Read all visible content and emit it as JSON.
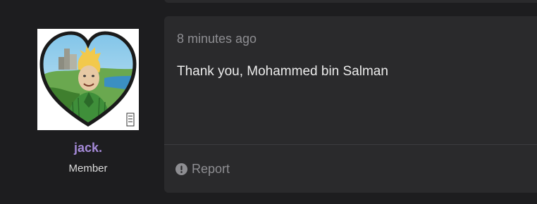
{
  "previous_post": {},
  "author": {
    "username": "jack.",
    "role": "Member",
    "username_color": "#a58ad8"
  },
  "post": {
    "timestamp": "8 minutes ago",
    "content": "Thank you, Mohammed bin Salman",
    "report_label": "Report",
    "report_icon": "exclamation-circle-icon"
  },
  "colors": {
    "page_background": "#1d1d1f",
    "card_background": "#2a2a2c",
    "muted_text": "#8e8e92",
    "body_text": "#ececec"
  }
}
